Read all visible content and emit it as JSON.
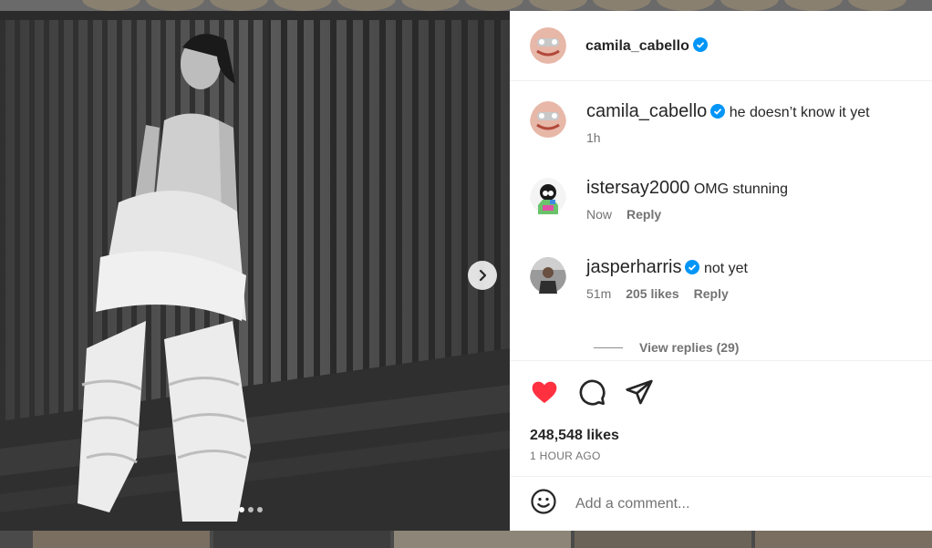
{
  "post": {
    "author": "camila_cabello",
    "verified": true,
    "image_count": 3,
    "active_image": 1
  },
  "comments": [
    {
      "user": "camila_cabello",
      "verified": true,
      "text": "he doesn’t know it yet",
      "time": "1h",
      "likes": "",
      "reply": ""
    },
    {
      "user": "istersay2000",
      "verified": false,
      "text": "OMG stunning",
      "time": "Now",
      "likes": "",
      "reply": "Reply"
    },
    {
      "user": "jasperharris",
      "verified": true,
      "text": "not yet",
      "time": "51m",
      "likes": "205 likes",
      "reply": "Reply"
    }
  ],
  "view_replies": "View replies (29)",
  "actions": {
    "liked": true,
    "like_color": "#ff3040",
    "icons": [
      "heart-icon",
      "comment-icon",
      "share-icon"
    ]
  },
  "likes_text": "248,548 likes",
  "time_ago": "1 HOUR AGO",
  "add_comment": {
    "placeholder": "Add a comment..."
  },
  "colors": {
    "verified": "#0095f6",
    "text": "#262626",
    "muted": "#737373"
  }
}
